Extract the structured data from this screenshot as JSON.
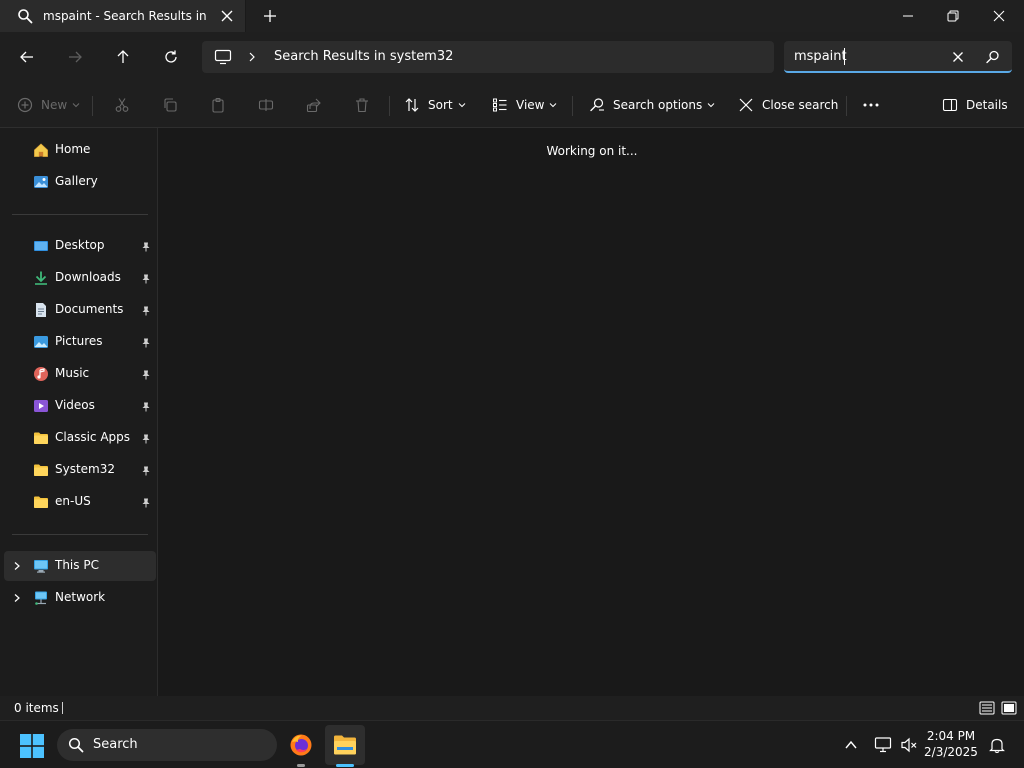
{
  "tab": {
    "title": "mspaint - Search Results in system32"
  },
  "address": {
    "location": "Search Results in system32"
  },
  "search": {
    "value": "mspaint"
  },
  "commands": {
    "new": "New",
    "sort": "Sort",
    "view": "View",
    "search_options": "Search options",
    "close_search": "Close search",
    "details": "Details"
  },
  "sidebar": {
    "top": [
      {
        "label": "Home",
        "icon": "home-icon"
      },
      {
        "label": "Gallery",
        "icon": "gallery-icon"
      }
    ],
    "pinned": [
      {
        "label": "Desktop",
        "icon": "desktop-folder-icon"
      },
      {
        "label": "Downloads",
        "icon": "downloads-icon"
      },
      {
        "label": "Documents",
        "icon": "documents-icon"
      },
      {
        "label": "Pictures",
        "icon": "pictures-icon"
      },
      {
        "label": "Music",
        "icon": "music-icon"
      },
      {
        "label": "Videos",
        "icon": "videos-icon"
      },
      {
        "label": "Classic Apps",
        "icon": "folder-icon"
      },
      {
        "label": "System32",
        "icon": "folder-icon"
      },
      {
        "label": "en-US",
        "icon": "folder-icon"
      }
    ],
    "tree": [
      {
        "label": "This PC",
        "icon": "this-pc-icon"
      },
      {
        "label": "Network",
        "icon": "network-icon"
      }
    ]
  },
  "content": {
    "status_message": "Working on it..."
  },
  "status": {
    "item_count": "0 items"
  },
  "taskbar": {
    "search_label": "Search",
    "time": "2:04 PM",
    "date": "2/3/2025"
  },
  "colors": {
    "accent": "#5aa9e6",
    "folder": "#f3c23c",
    "background": "#191919"
  }
}
